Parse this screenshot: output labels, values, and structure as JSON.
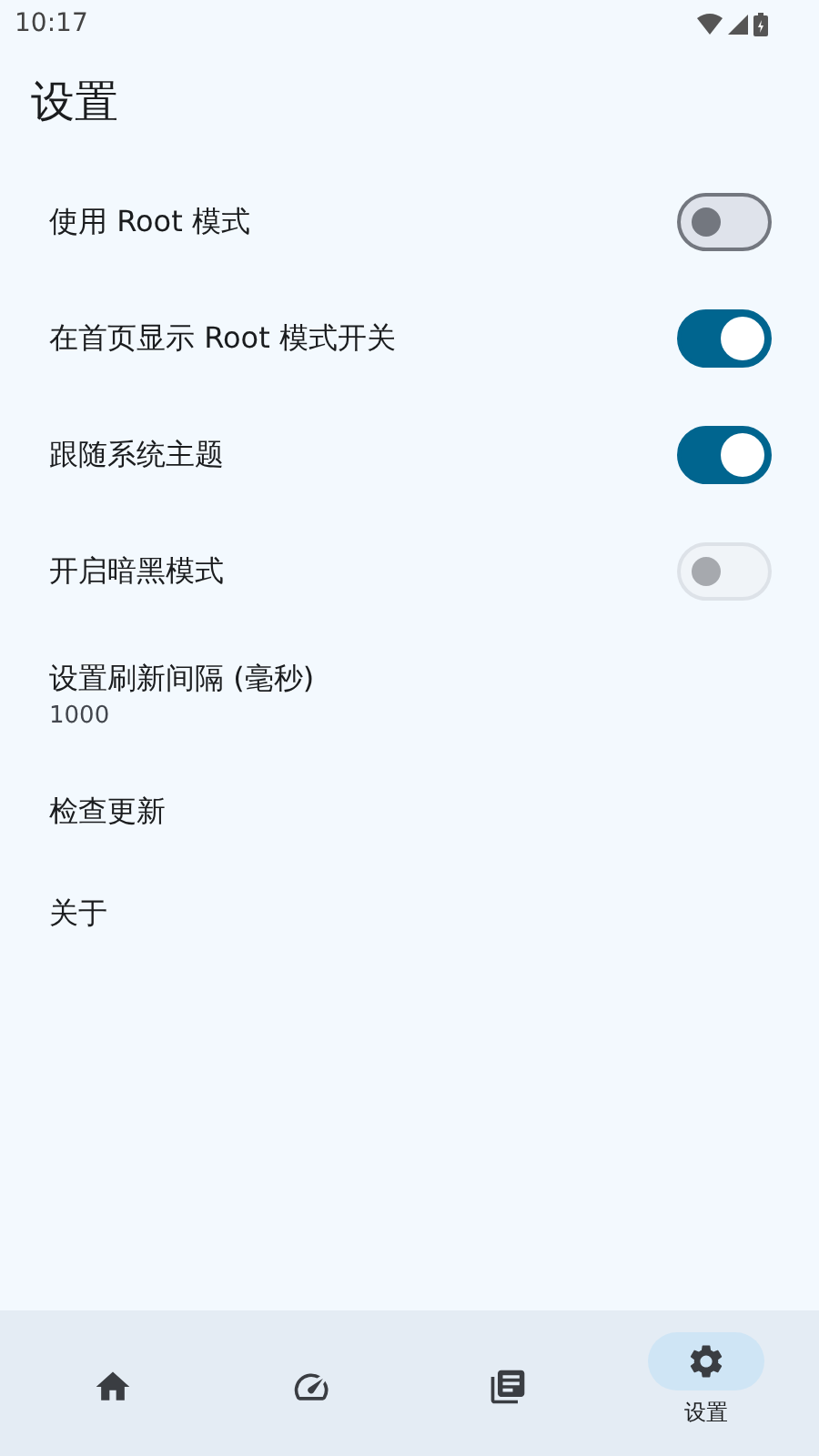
{
  "status_bar": {
    "time": "10:17"
  },
  "title": "设置",
  "settings": [
    {
      "kind": "switch",
      "label": "使用 Root 模式",
      "checked": false,
      "disabled": false
    },
    {
      "kind": "switch",
      "label": "在首页显示 Root 模式开关",
      "checked": true,
      "disabled": false
    },
    {
      "kind": "switch",
      "label": "跟随系统主题",
      "checked": true,
      "disabled": false
    },
    {
      "kind": "switch",
      "label": "开启暗黑模式",
      "checked": false,
      "disabled": true
    },
    {
      "kind": "value",
      "label": "设置刷新间隔 (毫秒)",
      "value": "1000"
    },
    {
      "kind": "link",
      "label": "检查更新"
    },
    {
      "kind": "link",
      "label": "关于"
    }
  ],
  "nav": [
    {
      "kind": "home",
      "selected": false
    },
    {
      "kind": "gauge",
      "selected": false
    },
    {
      "kind": "library",
      "selected": false
    },
    {
      "kind": "settings",
      "label": "设置",
      "selected": true
    }
  ]
}
